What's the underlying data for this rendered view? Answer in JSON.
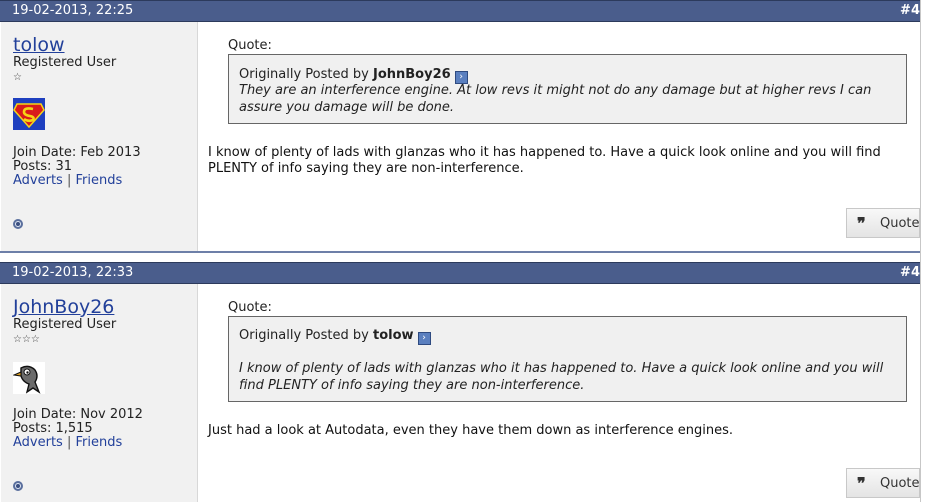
{
  "posts": [
    {
      "date": "19-02-2013, 22:25",
      "number": "#4",
      "username": "tolow",
      "user_title": "Registered User",
      "stars": "☆",
      "join_date": "Join Date: Feb 2013",
      "posts_count": "Posts: 31",
      "adverts_label": "Adverts",
      "sep": "|",
      "friends_label": "Friends",
      "quote_label": "Quote:",
      "quote_prefix": "Originally Posted by",
      "quote_author": "JohnBoy26",
      "quote_text": "They are an interference engine. At low revs it might not do any damage but at higher revs I can assure you damage will be done.",
      "message": "I know of plenty of lads with glanzas who it has happened to. Have a quick look online and you will find PLENTY of info saying they are non-interference.",
      "quote_button": "Quote",
      "avatar_icon": "superman-avatar-icon"
    },
    {
      "date": "19-02-2013, 22:33",
      "number": "#4",
      "username": "JohnBoy26",
      "user_title": "Registered User",
      "stars": "☆☆☆",
      "join_date": "Join Date: Nov 2012",
      "posts_count": "Posts: 1,515",
      "adverts_label": "Adverts",
      "sep": "|",
      "friends_label": "Friends",
      "quote_label": "Quote:",
      "quote_prefix": "Originally Posted by",
      "quote_author": "tolow",
      "quote_text": "I know of plenty of lads with glanzas who it has happened to. Have a quick look online and you will find PLENTY of info saying they are non-interference.",
      "message": "Just had a look at Autodata, even they have them down as interference engines.",
      "quote_button": "Quote",
      "avatar_icon": "bird-avatar-icon"
    }
  ],
  "colors": {
    "header_bg": "#4a5d8c",
    "link": "#22409a",
    "sidebar_bg": "#f1f1f1",
    "quote_bg": "#f0f0f0"
  }
}
